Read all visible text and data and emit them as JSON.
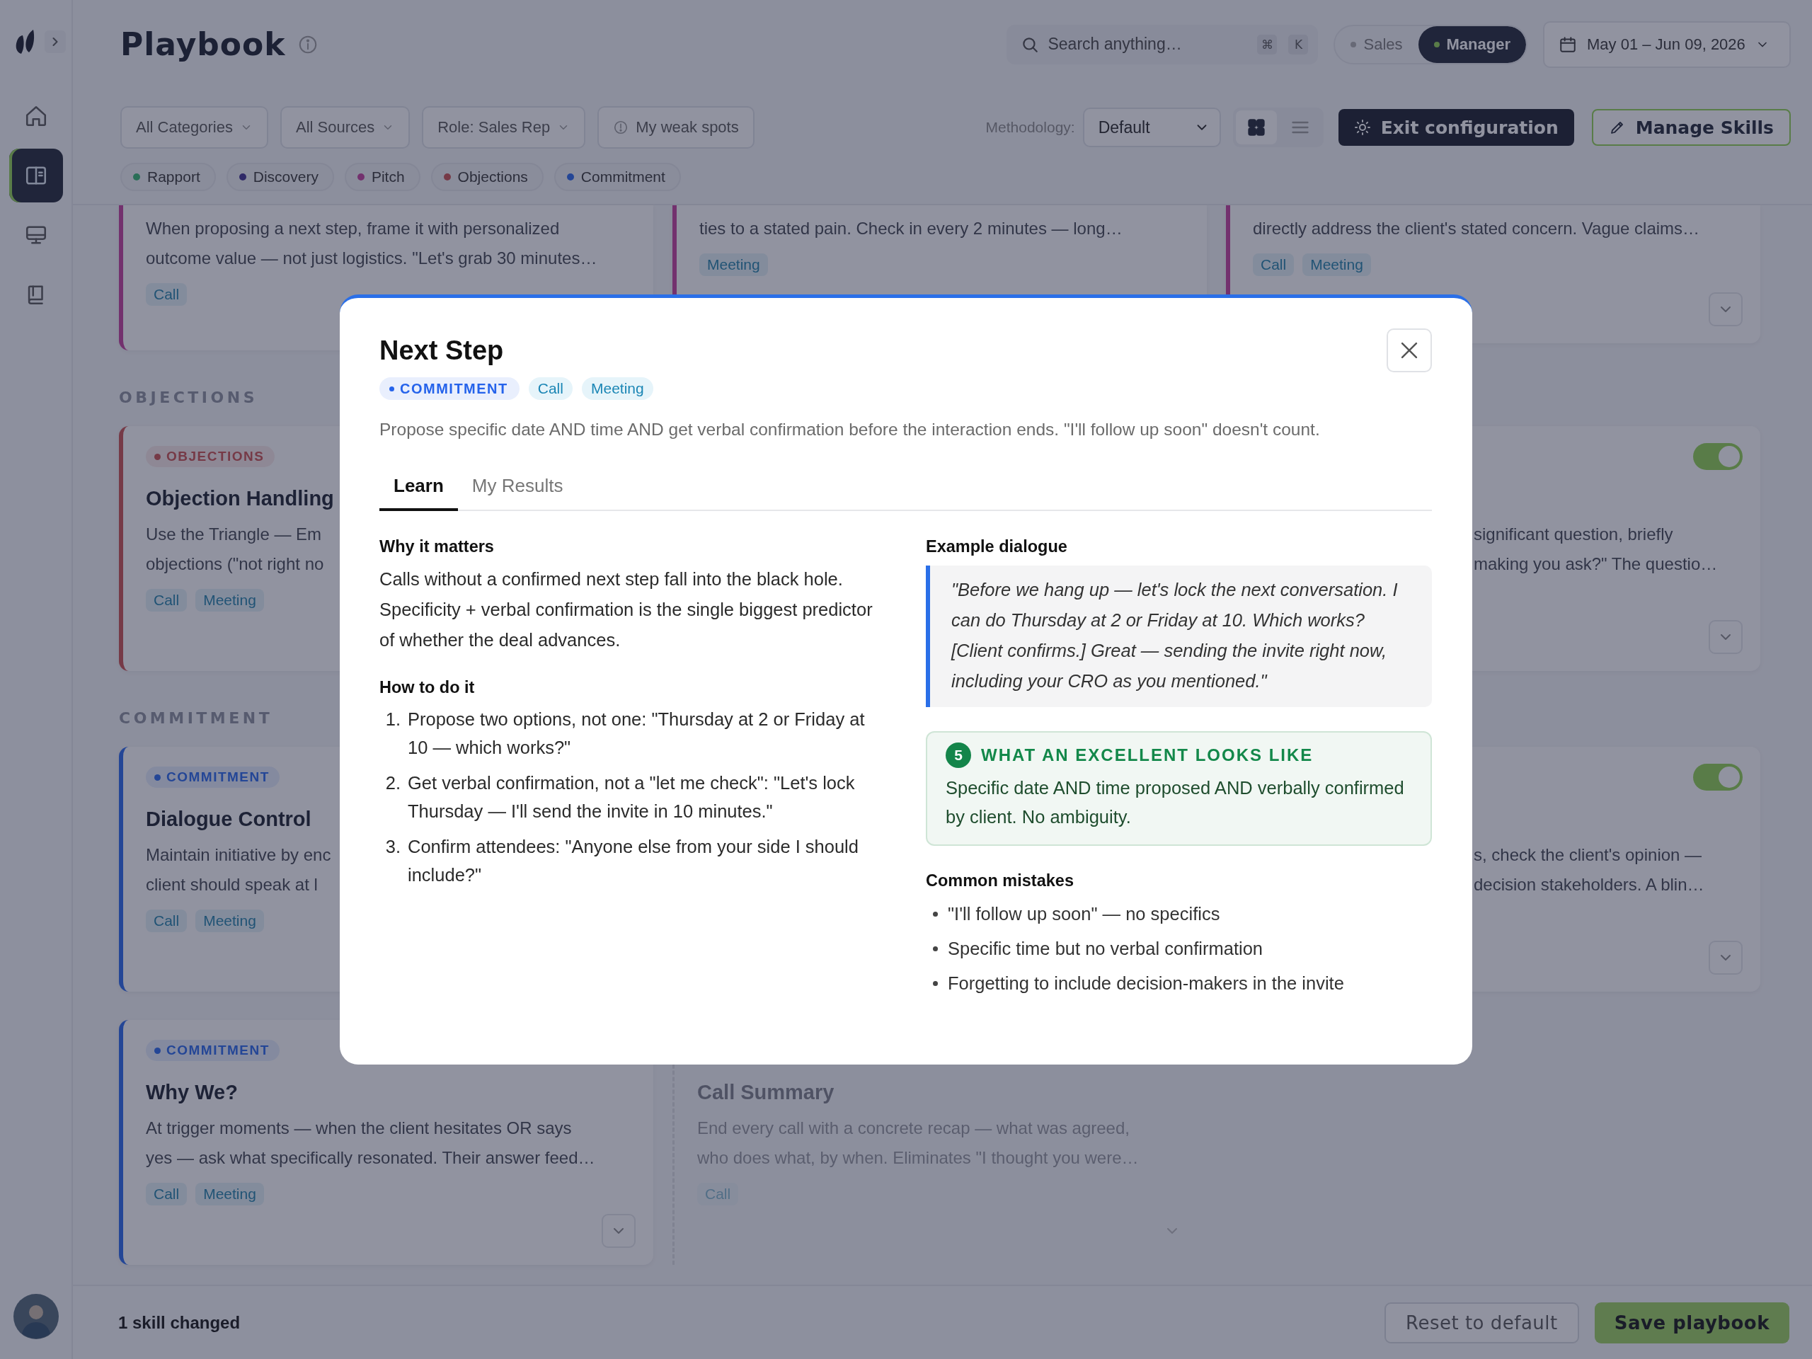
{
  "sidebar": {
    "items": [
      {
        "kind": "home",
        "selected": false
      },
      {
        "kind": "playbook",
        "selected": true
      },
      {
        "kind": "monitor",
        "selected": false
      },
      {
        "kind": "book",
        "selected": false
      }
    ]
  },
  "header": {
    "title": "Playbook",
    "search": {
      "placeholder": "Search anything…",
      "keys": [
        "⌘",
        "K"
      ]
    },
    "roles": [
      {
        "label": "Sales",
        "selected": false
      },
      {
        "label": "Manager",
        "selected": true
      }
    ],
    "date_range": "May 01 – Jun 09, 2026"
  },
  "filters": {
    "dropdowns": [
      "All Categories",
      "All Sources",
      "Role: Sales Rep"
    ],
    "weak_spots": "My weak spots",
    "methodology_label": "Methodology:",
    "methodology": "Default",
    "views": [
      {
        "kind": "grid",
        "selected": true
      },
      {
        "kind": "list",
        "selected": false
      }
    ],
    "exit_button": "Exit configuration",
    "manage_button": "Manage Skills"
  },
  "categories": [
    {
      "label": "Rapport",
      "color": "#2a6e57"
    },
    {
      "label": "Discovery",
      "color": "#2f2967"
    },
    {
      "label": "Pitch",
      "color": "#73316e"
    },
    {
      "label": "Objections",
      "color": "#763a47"
    },
    {
      "label": "Commitment",
      "color": "#244696"
    }
  ],
  "groups": [
    {
      "rows": [
        [
          {
            "kind": "full",
            "color": "#73316e",
            "lines": [
              "When proposing a next step, frame it with personalized",
              "outcome value — not just logistics. \"Let's grab 30 minutes…"
            ],
            "tags": [
              "Call"
            ],
            "expandable": false
          },
          {
            "kind": "full",
            "color": "#73316e",
            "lines": [
              "ties to a stated pain. Check in every 2 minutes — long…"
            ],
            "tags": [
              "Meeting"
            ],
            "expandable": false
          },
          {
            "kind": "full",
            "color": "#73316e",
            "lines": [
              "directly address the client's stated concern. Vague claims…"
            ],
            "tags": [
              "Call",
              "Meeting"
            ],
            "expandable": true
          }
        ]
      ]
    },
    {
      "heading": "OBJECTIONS",
      "rows": [
        [
          {
            "kind": "full",
            "color": "#763a47",
            "badge": {
              "label": "OBJECTIONS",
              "color": "#763a47"
            },
            "title": "Objection Handling",
            "lines": [
              "Use the Triangle — Em",
              "objections (\"not right no"
            ],
            "tags": [
              "Call",
              "Meeting"
            ],
            "expandable": false
          },
          null,
          {
            "kind": "partial",
            "toggle": {
              "on": true
            },
            "lines": [
              "significant question, briefly",
              "making you ask?\" The questio…"
            ],
            "expandable": true
          }
        ]
      ]
    },
    {
      "heading": "COMMITMENT",
      "rows": [
        [
          {
            "kind": "full",
            "color": "#244696",
            "badge": {
              "label": "COMMITMENT",
              "color": "#244696"
            },
            "title": "Dialogue Control",
            "lines": [
              "Maintain initiative by enc",
              "client should speak at l"
            ],
            "tags": [
              "Call",
              "Meeting"
            ],
            "expandable": false
          },
          null,
          {
            "kind": "partial",
            "toggle": {
              "on": true
            },
            "lines": [
              "s, check the client's opinion —",
              "decision stakeholders. A blin…"
            ],
            "expandable": true
          }
        ],
        [
          {
            "kind": "full",
            "color": "#244696",
            "badge": {
              "label": "COMMITMENT",
              "color": "#244696"
            },
            "title": "Why We?",
            "lines": [
              "At trigger moments — when the client hesitates OR says",
              "yes — ask what specifically resonated. Their answer feed…"
            ],
            "tags": [
              "Call",
              "Meeting"
            ],
            "expandable": true
          },
          {
            "kind": "disabled",
            "title": "Call Summary",
            "lines": [
              "End every call with a concrete recap — what was agreed,",
              "who does what, by when. Eliminates \"I thought you were…"
            ],
            "tags": [
              "Call"
            ],
            "expandable": true
          },
          null
        ]
      ]
    }
  ],
  "footer": {
    "status": "1 skill changed",
    "reset_button": "Reset to default",
    "save_button": "Save playbook"
  },
  "modal": {
    "title": "Next Step",
    "badge": {
      "label": "COMMITMENT",
      "color": "#2563eb"
    },
    "tags": [
      "Call",
      "Meeting"
    ],
    "description": "Propose specific date AND time AND get verbal confirmation before the interaction ends. \"I'll follow up soon\" doesn't count.",
    "tabs": [
      {
        "label": "Learn",
        "selected": true
      },
      {
        "label": "My Results",
        "selected": false
      }
    ],
    "why_heading": "Why it matters",
    "why_text": "Calls without a confirmed next step fall into the black hole. Specificity + verbal confirmation is the single biggest predictor of whether the deal advances.",
    "how_heading": "How to do it",
    "steps": [
      {
        "number": "1.",
        "text": "Propose two options, not one: \"Thursday at 2 or Friday at 10 — which works?\""
      },
      {
        "number": "2.",
        "text": "Get verbal confirmation, not a \"let me check\": \"Let's lock Thursday — I'll send the invite in 10 minutes.\""
      },
      {
        "number": "3.",
        "text": "Confirm attendees: \"Anyone else from your side I should include?\""
      }
    ],
    "example_heading": "Example dialogue",
    "example_quote": "\"Before we hang up — let's lock the next conversation. I can do Thursday at 2 or Friday at 10. Which works? [Client confirms.] Great — sending the invite right now, including your CRO as you mentioned.\"",
    "excellent": {
      "score": "5",
      "heading": "WHAT AN EXCELLENT LOOKS LIKE",
      "text": "Specific date AND time proposed AND verbally confirmed by client. No ambiguity."
    },
    "mistakes_heading": "Common mistakes",
    "mistakes": [
      "\"I'll follow up soon\" — no specifics",
      "Specific time but no verbal confirmation",
      "Forgetting to include decision-makers in the invite"
    ]
  }
}
